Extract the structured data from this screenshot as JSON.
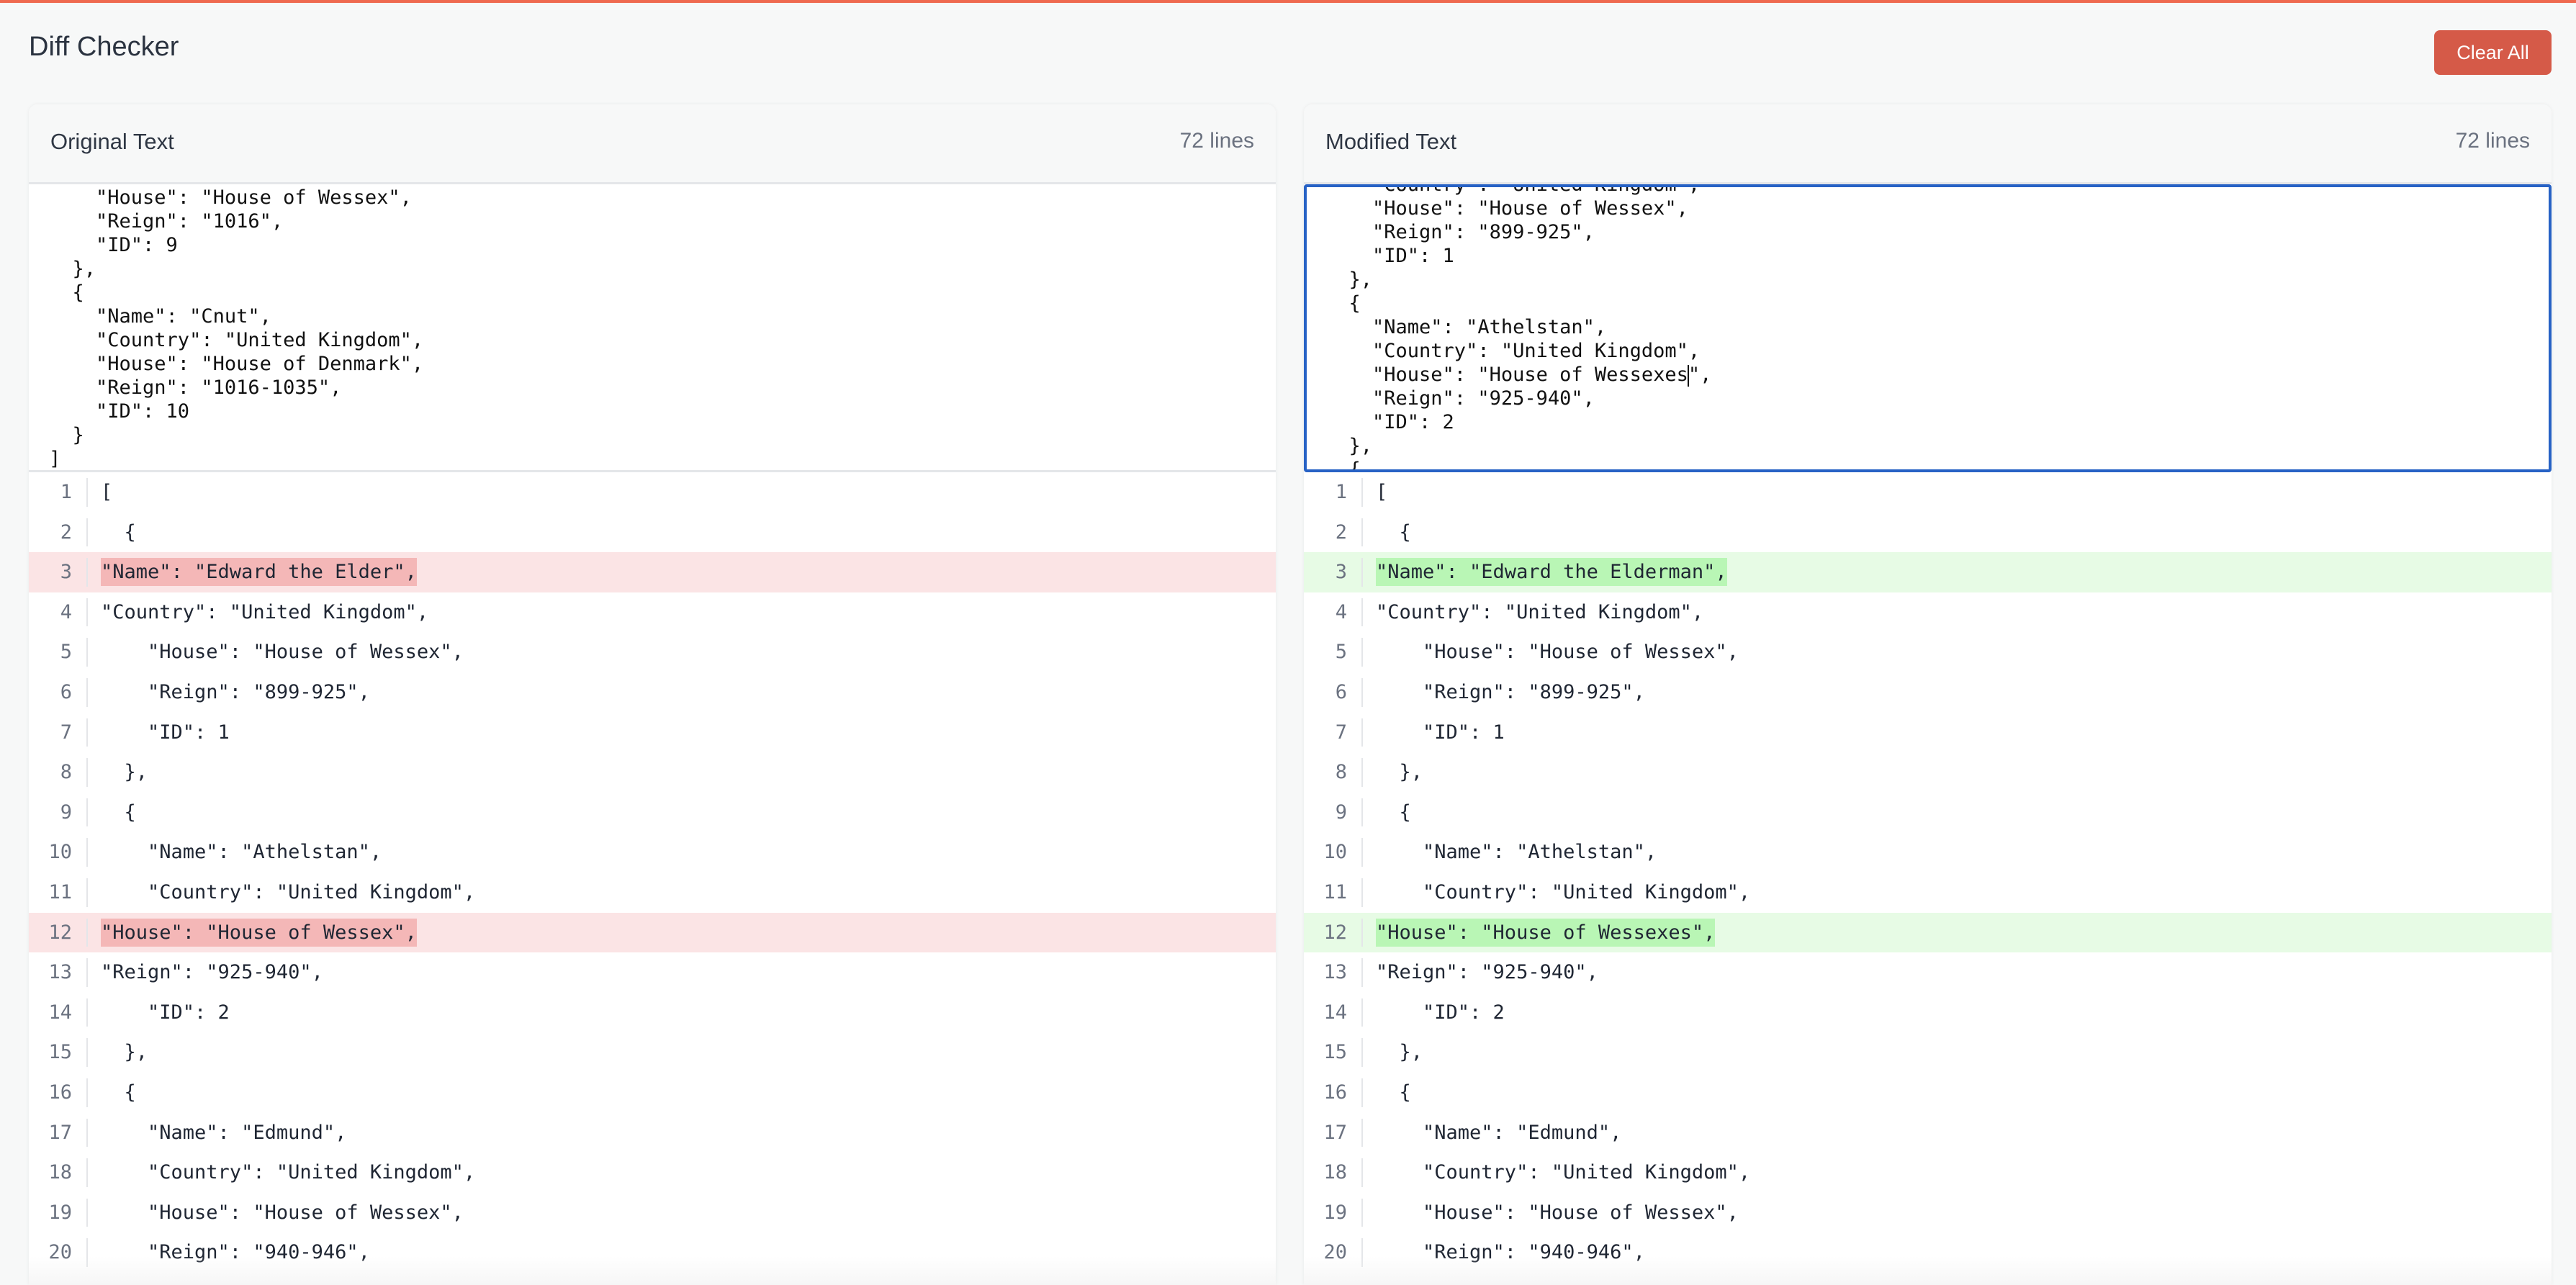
{
  "app": {
    "title": "Diff Checker",
    "clear_button": "Clear All",
    "accent_color": "#d55a48",
    "top_bar_color": "#ef6a50"
  },
  "original": {
    "title": "Original Text",
    "line_count": "72 lines",
    "editor_lines": [
      "    \"House\": \"House of Wessex\",",
      "    \"Reign\": \"1016\",",
      "    \"ID\": 9",
      "  },",
      "  {",
      "    \"Name\": \"Cnut\",",
      "    \"Country\": \"United Kingdom\",",
      "    \"House\": \"House of Denmark\",",
      "    \"Reign\": \"1016-1035\",",
      "    \"ID\": 10",
      "  }",
      "]"
    ],
    "diff_rows": [
      {
        "num": "1",
        "text": "[",
        "type": "same"
      },
      {
        "num": "2",
        "text": "  {",
        "type": "same"
      },
      {
        "num": "3",
        "text": "\"Name\": \"Edward the Elder\",",
        "type": "removed"
      },
      {
        "num": "4",
        "text": "\"Country\": \"United Kingdom\",",
        "type": "same"
      },
      {
        "num": "5",
        "text": "    \"House\": \"House of Wessex\",",
        "type": "same"
      },
      {
        "num": "6",
        "text": "    \"Reign\": \"899-925\",",
        "type": "same"
      },
      {
        "num": "7",
        "text": "    \"ID\": 1",
        "type": "same"
      },
      {
        "num": "8",
        "text": "  },",
        "type": "same"
      },
      {
        "num": "9",
        "text": "  {",
        "type": "same"
      },
      {
        "num": "10",
        "text": "    \"Name\": \"Athelstan\",",
        "type": "same"
      },
      {
        "num": "11",
        "text": "    \"Country\": \"United Kingdom\",",
        "type": "same"
      },
      {
        "num": "12",
        "text": "\"House\": \"House of Wessex\",",
        "type": "removed"
      },
      {
        "num": "13",
        "text": "\"Reign\": \"925-940\",",
        "type": "same"
      },
      {
        "num": "14",
        "text": "    \"ID\": 2",
        "type": "same"
      },
      {
        "num": "15",
        "text": "  },",
        "type": "same"
      },
      {
        "num": "16",
        "text": "  {",
        "type": "same"
      },
      {
        "num": "17",
        "text": "    \"Name\": \"Edmund\",",
        "type": "same"
      },
      {
        "num": "18",
        "text": "    \"Country\": \"United Kingdom\",",
        "type": "same"
      },
      {
        "num": "19",
        "text": "    \"House\": \"House of Wessex\",",
        "type": "same"
      },
      {
        "num": "20",
        "text": "    \"Reign\": \"940-946\",",
        "type": "same"
      }
    ]
  },
  "modified": {
    "title": "Modified Text",
    "line_count": "72 lines",
    "editor_lines": [
      "    \"Country\": \"United Kingdom\",",
      "    \"House\": \"House of Wessex\",",
      "    \"Reign\": \"899-925\",",
      "    \"ID\": 1",
      "  },",
      "  {",
      "    \"Name\": \"Athelstan\",",
      "    \"Country\": \"United Kingdom\",",
      "    \"House\": \"House of Wessexes|\",",
      "    \"Reign\": \"925-940\",",
      "    \"ID\": 2",
      "  },",
      "  {"
    ],
    "diff_rows": [
      {
        "num": "1",
        "text": "[",
        "type": "same"
      },
      {
        "num": "2",
        "text": "  {",
        "type": "same"
      },
      {
        "num": "3",
        "text": "\"Name\": \"Edward the Elderman\",",
        "type": "added"
      },
      {
        "num": "4",
        "text": "\"Country\": \"United Kingdom\",",
        "type": "same"
      },
      {
        "num": "5",
        "text": "    \"House\": \"House of Wessex\",",
        "type": "same"
      },
      {
        "num": "6",
        "text": "    \"Reign\": \"899-925\",",
        "type": "same"
      },
      {
        "num": "7",
        "text": "    \"ID\": 1",
        "type": "same"
      },
      {
        "num": "8",
        "text": "  },",
        "type": "same"
      },
      {
        "num": "9",
        "text": "  {",
        "type": "same"
      },
      {
        "num": "10",
        "text": "    \"Name\": \"Athelstan\",",
        "type": "same"
      },
      {
        "num": "11",
        "text": "    \"Country\": \"United Kingdom\",",
        "type": "same"
      },
      {
        "num": "12",
        "text": "\"House\": \"House of Wessexes\",",
        "type": "added"
      },
      {
        "num": "13",
        "text": "\"Reign\": \"925-940\",",
        "type": "same"
      },
      {
        "num": "14",
        "text": "    \"ID\": 2",
        "type": "same"
      },
      {
        "num": "15",
        "text": "  },",
        "type": "same"
      },
      {
        "num": "16",
        "text": "  {",
        "type": "same"
      },
      {
        "num": "17",
        "text": "    \"Name\": \"Edmund\",",
        "type": "same"
      },
      {
        "num": "18",
        "text": "    \"Country\": \"United Kingdom\",",
        "type": "same"
      },
      {
        "num": "19",
        "text": "    \"House\": \"House of Wessex\",",
        "type": "same"
      },
      {
        "num": "20",
        "text": "    \"Reign\": \"940-946\",",
        "type": "same"
      }
    ]
  }
}
